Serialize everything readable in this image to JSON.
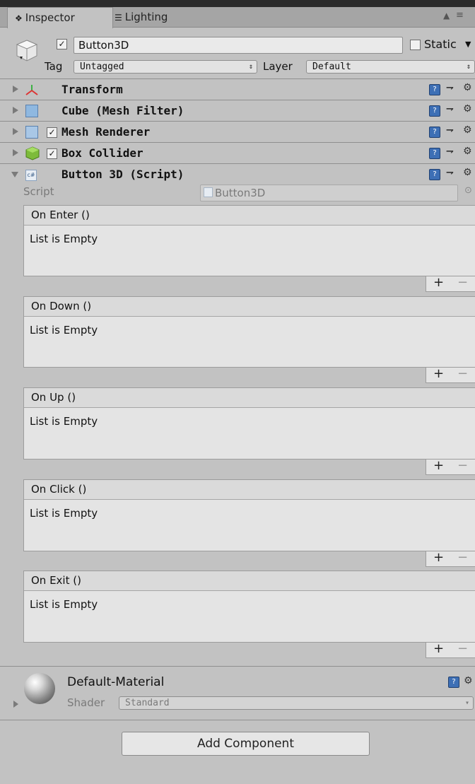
{
  "tabs": [
    {
      "icon": "info-icon",
      "label": "Inspector"
    },
    {
      "icon": "lighting-icon",
      "label": "Lighting"
    }
  ],
  "gameobject": {
    "active": true,
    "name": "Button3D",
    "static_label": "Static",
    "static": false,
    "tag_label": "Tag",
    "tag_value": "Untagged",
    "layer_label": "Layer",
    "layer_value": "Default"
  },
  "components": [
    {
      "name": "Transform",
      "icon": "transform-icon",
      "expanded": false,
      "has_toggle": false
    },
    {
      "name": "Cube (Mesh Filter)",
      "icon": "mesh-filter-icon",
      "expanded": false,
      "has_toggle": false
    },
    {
      "name": "Mesh Renderer",
      "icon": "mesh-renderer-icon",
      "expanded": false,
      "has_toggle": true
    },
    {
      "name": "Box Collider",
      "icon": "box-collider-icon",
      "expanded": false,
      "has_toggle": true
    },
    {
      "name": "Button 3D (Script)",
      "icon": "script-icon",
      "expanded": true,
      "has_toggle": false
    }
  ],
  "script": {
    "label": "Script",
    "value": "Button3D"
  },
  "events": [
    {
      "title": "On Enter ()",
      "empty_text": "List is Empty"
    },
    {
      "title": "On Down ()",
      "empty_text": "List is Empty"
    },
    {
      "title": "On Up ()",
      "empty_text": "List is Empty"
    },
    {
      "title": "On Click ()",
      "empty_text": "List is Empty"
    },
    {
      "title": "On Exit ()",
      "empty_text": "List is Empty"
    }
  ],
  "event_buttons": {
    "add": "+",
    "remove": "−"
  },
  "material": {
    "name": "Default-Material",
    "shader_label": "Shader",
    "shader_value": "Standard"
  },
  "add_component_label": "Add Component"
}
